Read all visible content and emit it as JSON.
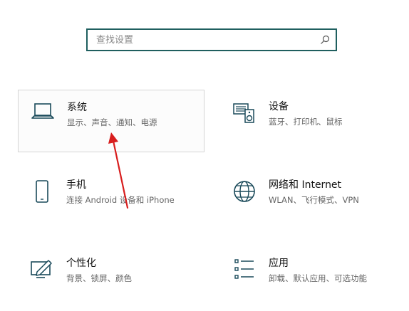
{
  "search": {
    "placeholder": "查找设置"
  },
  "tiles": [
    {
      "title": "系统",
      "desc": "显示、声音、通知、电源",
      "icon": "laptop-icon"
    },
    {
      "title": "设备",
      "desc": "蓝牙、打印机、鼠标",
      "icon": "devices-icon"
    },
    {
      "title": "手机",
      "desc": "连接 Android 设备和 iPhone",
      "icon": "phone-icon"
    },
    {
      "title": "网络和 Internet",
      "desc": "WLAN、飞行模式、VPN",
      "icon": "globe-icon"
    },
    {
      "title": "个性化",
      "desc": "背景、锁屏、颜色",
      "icon": "personalization-icon"
    },
    {
      "title": "应用",
      "desc": "卸载、默认应用、可选功能",
      "icon": "apps-list-icon"
    }
  ],
  "colors": {
    "accent": "#1f5f5f",
    "icon": "#1a4a5a",
    "annotation_arrow": "#d81e1e"
  }
}
